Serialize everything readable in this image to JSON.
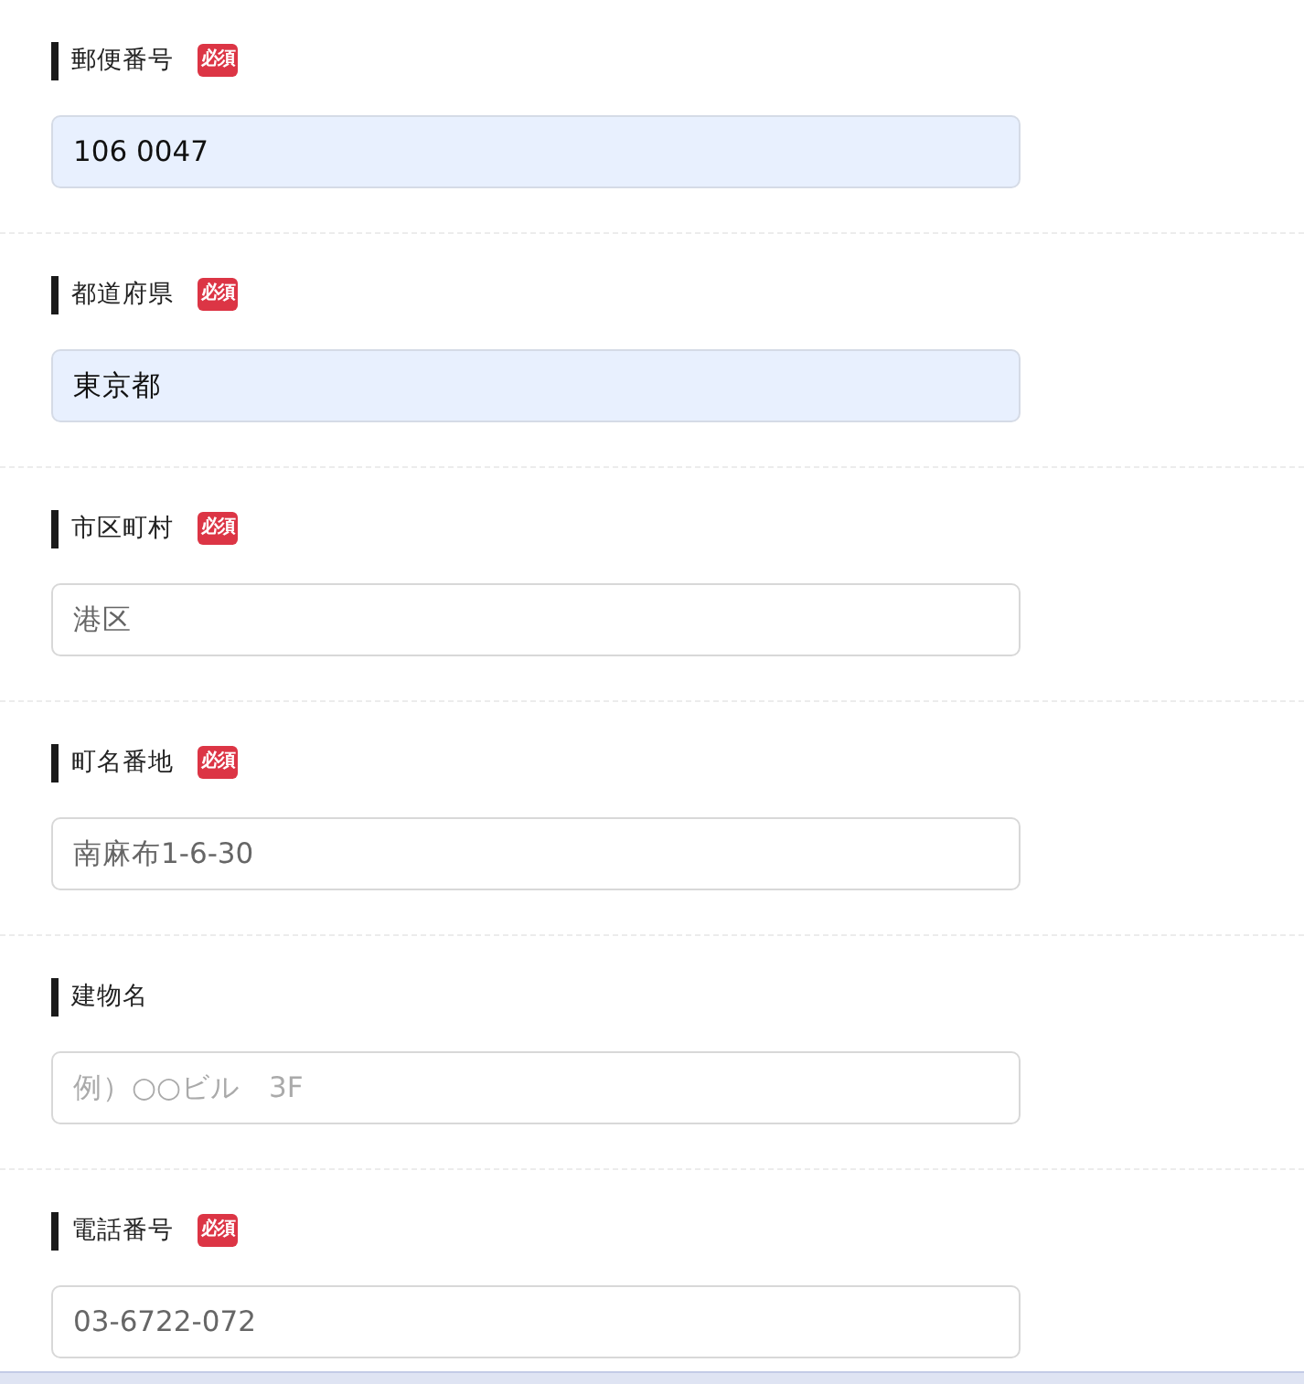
{
  "fields": [
    {
      "label": "郵便番号",
      "badge": "必須",
      "value": "106 0047",
      "autofilled": true
    },
    {
      "label": "都道府県",
      "badge": "必須",
      "value": "東京都",
      "autofilled": true
    },
    {
      "label": "市区町村",
      "badge": "必須",
      "value": "港区",
      "autofilled": false
    },
    {
      "label": "町名番地",
      "badge": "必須",
      "value": "南麻布1-6-30",
      "autofilled": false
    },
    {
      "label": "建物名",
      "placeholder": "例）○○ビル　3F",
      "autofilled": false
    },
    {
      "label": "電話番号",
      "badge": "必須",
      "value": "03-6722-072",
      "autofilled": false
    }
  ]
}
